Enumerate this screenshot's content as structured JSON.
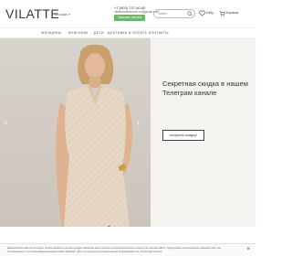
{
  "header": {
    "logo": "VILATTE",
    "city": "Москва",
    "phone": "+7 (903) 737-40-00",
    "email": "vilattelicdressme.ru@gmail.com",
    "callback_label": "Заказать звонок",
    "search_placeholder": "найти",
    "wishlist_label": "Избр.",
    "cart_label": "Корзина",
    "accent_color": "#6cb86a"
  },
  "nav": {
    "items": [
      "ЖЕНЩИНЫ",
      "МУЖЧИНЫ",
      "ДЕТИ",
      "ДОСТАВКА И ОПЛАТА",
      "КОНТАКТЫ"
    ]
  },
  "hero": {
    "title": "Секретная скидка в нашем Телеграм канале",
    "cta_label": "получить скидку!",
    "slide_count": 4,
    "active_slide": 1
  },
  "cookie": {
    "text": "Данный веб-сайт использует cookie-файлы в целях предоставления вам лучшего пользовательского опыта на нашем сайте. Продолжая использовать данный сайт, вы соглашаетесь с использованием нами cookie-файлов. Для получения дополнительной информации см. Политика Cookie",
    "close_label": "×"
  }
}
